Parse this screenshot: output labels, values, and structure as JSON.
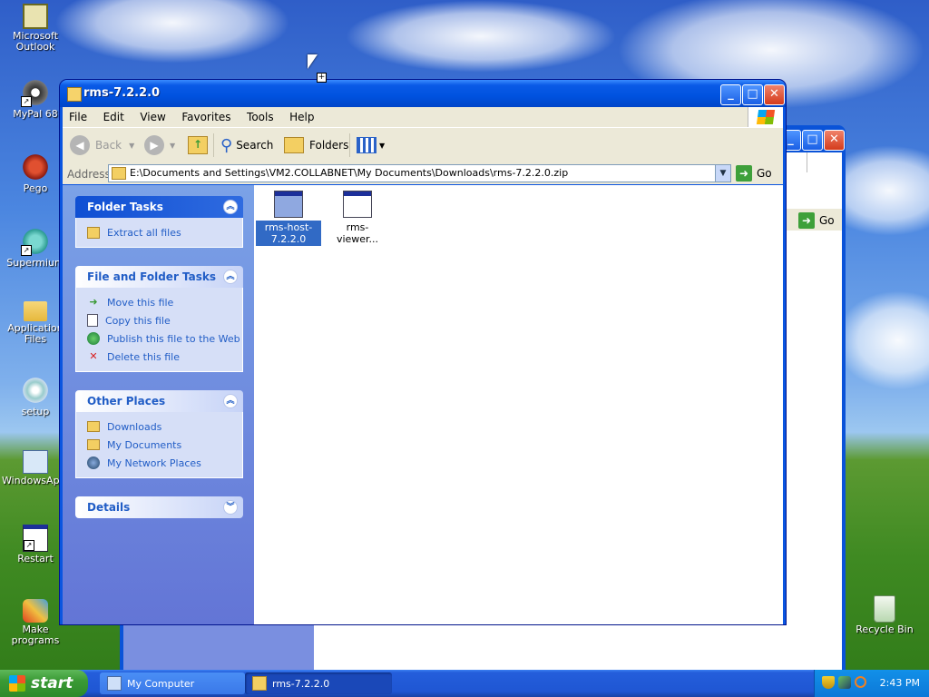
{
  "desktop": {
    "icons": [
      {
        "label": "Microsoft Outlook",
        "icon": "outlook-icon"
      },
      {
        "label": "MyPal 68",
        "icon": "mypal-icon"
      },
      {
        "label": "Pego",
        "icon": "pego-icon"
      },
      {
        "label": "Supermium",
        "icon": "supermium-icon"
      },
      {
        "label": "Application Files",
        "icon": "folder-icon"
      },
      {
        "label": "setup",
        "icon": "setup-icon"
      },
      {
        "label": "WindowsAp...",
        "icon": "windows-app-icon"
      },
      {
        "label": "Restart",
        "icon": "restart-icon"
      },
      {
        "label": "Make programs",
        "icon": "make-programs-icon"
      },
      {
        "label": "Recycle Bin",
        "icon": "recycle-bin-icon"
      }
    ]
  },
  "window": {
    "title": "rms-7.2.2.0",
    "menu": [
      "File",
      "Edit",
      "View",
      "Favorites",
      "Tools",
      "Help"
    ],
    "toolbar": {
      "back": "Back",
      "search": "Search",
      "folders": "Folders"
    },
    "address": {
      "label": "Address",
      "value": "E:\\Documents and Settings\\VM2.COLLABNET\\My Documents\\Downloads\\rms-7.2.2.0.zip",
      "go": "Go"
    },
    "folder_tasks": {
      "title": "Folder Tasks",
      "items": [
        "Extract all files"
      ]
    },
    "file_folder_tasks": {
      "title": "File and Folder Tasks",
      "items": [
        "Move this file",
        "Copy this file",
        "Publish this file to the Web",
        "Delete this file"
      ]
    },
    "other_places": {
      "title": "Other Places",
      "items": [
        "Downloads",
        "My Documents",
        "My Network Places"
      ]
    },
    "details": {
      "title": "Details"
    },
    "files": [
      {
        "name": "rms-host-7.2.2.0",
        "selected": true
      },
      {
        "name": "rms-viewer...",
        "selected": false
      }
    ]
  },
  "background_window": {
    "go": "Go"
  },
  "taskbar": {
    "start": "start",
    "tasks": [
      "My Computer",
      "rms-7.2.2.0"
    ],
    "clock": "2:43 PM"
  }
}
